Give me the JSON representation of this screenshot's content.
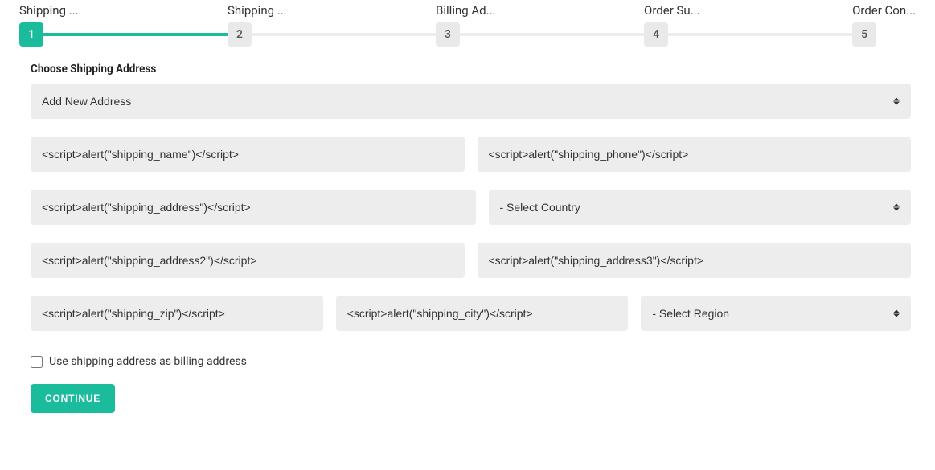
{
  "stepper": {
    "steps": [
      {
        "label": "Shipping ...",
        "number": "1",
        "active": true
      },
      {
        "label": "Shipping ...",
        "number": "2",
        "active": false
      },
      {
        "label": "Billing Ad...",
        "number": "3",
        "active": false
      },
      {
        "label": "Order Su...",
        "number": "4",
        "active": false
      },
      {
        "label": "Order Con...",
        "number": "5",
        "active": false
      }
    ]
  },
  "form": {
    "section_label": "Choose Shipping Address",
    "address_select": "Add New Address",
    "name": "<script>alert(\"shipping_name\")</​script>",
    "phone": "<script>alert(\"shipping_phone\")</​script>",
    "address": "<script>alert(\"shipping_address\")</​script>",
    "country": "- Select Country",
    "address2": "<script>alert(\"shipping_address2\")</​script>",
    "address3": "<script>alert(\"shipping_address3\")</​script>",
    "zip": "<script>alert(\"shipping_zip\")</​script>",
    "city": "<script>alert(\"shipping_city\")</​script>",
    "region": "- Select Region",
    "checkbox_label": "Use shipping address as billing address",
    "continue_label": "CONTINUE"
  }
}
